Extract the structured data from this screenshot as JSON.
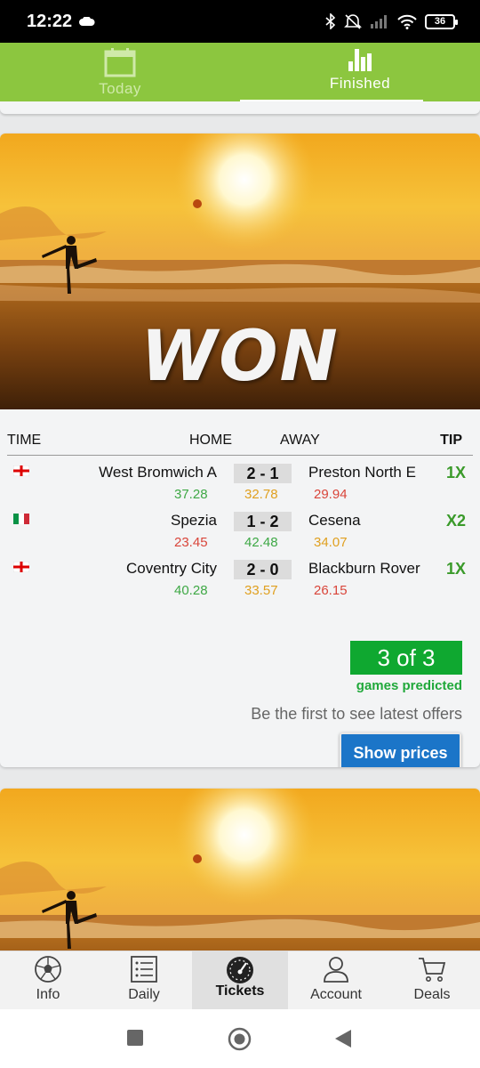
{
  "status_bar": {
    "time": "12:22",
    "battery": "36"
  },
  "top_tabs": [
    {
      "label": "Today",
      "icon": "calendar-icon",
      "active": false
    },
    {
      "label": "Finished",
      "icon": "bar-chart-icon",
      "active": true
    }
  ],
  "card": {
    "banner_text": "WON",
    "table_header": {
      "time": "TIME",
      "home": "HOME",
      "away": "AWAY",
      "tip": "TIP"
    },
    "matches": [
      {
        "flag": "england",
        "home": "West Bromwich A",
        "score": "2 - 1",
        "away": "Preston North E",
        "tip": "1X",
        "odd_home": "37.28",
        "odd_draw": "32.78",
        "odd_away": "29.94"
      },
      {
        "flag": "italy",
        "home": "Spezia",
        "score": "1 - 2",
        "away": "Cesena",
        "tip": "X2",
        "odd_home": "23.45",
        "odd_draw": "42.48",
        "odd_away": "34.07"
      },
      {
        "flag": "england",
        "home": "Coventry City",
        "score": "2 - 0",
        "away": "Blackburn Rover",
        "tip": "1X",
        "odd_home": "40.28",
        "odd_draw": "33.57",
        "odd_away": "26.15"
      }
    ],
    "predicted": "3 of 3",
    "predicted_sub": "games predicted",
    "offer_text": "Be the first to see latest offers",
    "show_prices": "Show prices"
  },
  "bottom_nav": [
    {
      "label": "Info",
      "icon": "soccer-ball-icon",
      "active": false
    },
    {
      "label": "Daily",
      "icon": "list-icon",
      "active": false
    },
    {
      "label": "Tickets",
      "icon": "speedometer-icon",
      "active": true
    },
    {
      "label": "Account",
      "icon": "user-icon",
      "active": false
    },
    {
      "label": "Deals",
      "icon": "cart-icon",
      "active": false
    }
  ],
  "colors": {
    "accent_green": "#8cc63f",
    "tip_green": "#3a9a2a",
    "odd_green": "#3ea845",
    "odd_orange": "#e0a020",
    "odd_red": "#d9453a",
    "button_blue": "#1b75c8"
  }
}
